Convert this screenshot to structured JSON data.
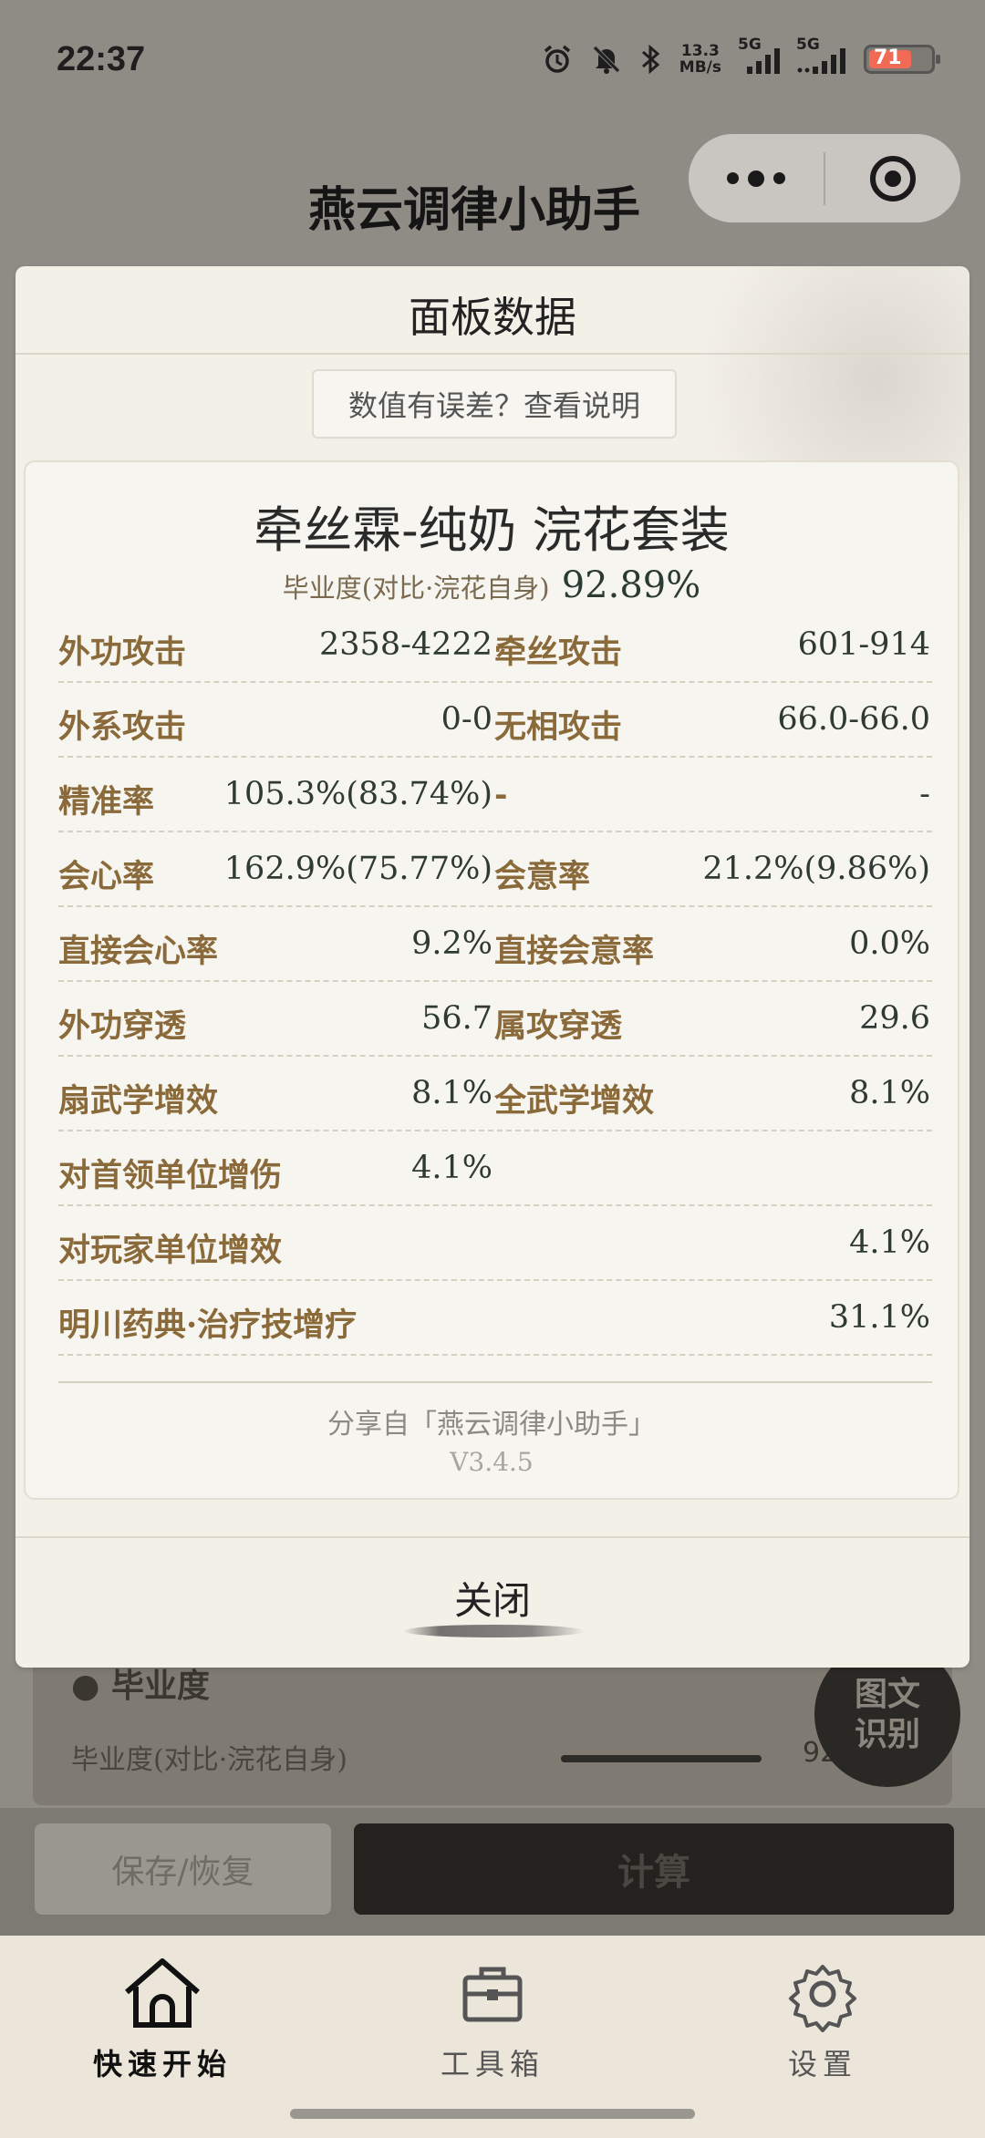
{
  "status_bar": {
    "time": "22:37",
    "net_speed_value": "13.3",
    "net_speed_unit": "MB/s",
    "sim1_label": "5G",
    "sim2_label": "5G",
    "battery": "71",
    "icons": [
      "alarm-icon",
      "mute-icon",
      "bluetooth-icon",
      "signal-icon",
      "battery-icon"
    ]
  },
  "app": {
    "title": "燕云调律小助手"
  },
  "capsule": {
    "icons": [
      "more-icon",
      "target-icon"
    ]
  },
  "modal": {
    "title": "面板数据",
    "error_link": "数值有误差？查看说明",
    "set_title": "牵丝霖-纯奶 浣花套装",
    "score_label": "毕业度(对比·浣花自身)",
    "score_value": "92.89%",
    "rows": [
      {
        "l1": "外功攻击",
        "v1": "2358-4222",
        "l2": "牵丝攻击",
        "v2": "601-914"
      },
      {
        "l1": "外系攻击",
        "v1": "0-0",
        "l2": "无相攻击",
        "v2": "66.0-66.0"
      },
      {
        "l1": "精准率",
        "v1": "105.3%(83.74%)",
        "l2": "-",
        "v2": "-"
      },
      {
        "l1": "会心率",
        "v1": "162.9%(75.77%)",
        "l2": "会意率",
        "v2": "21.2%(9.86%)"
      },
      {
        "l1": "直接会心率",
        "v1": "9.2%",
        "l2": "直接会意率",
        "v2": "0.0%"
      },
      {
        "l1": "外功穿透",
        "v1": "56.7",
        "l2": "属攻穿透",
        "v2": "29.6"
      },
      {
        "l1": "扇武学增效",
        "v1": "8.1%",
        "l2": "全武学增效",
        "v2": "8.1%"
      },
      {
        "l1": "对首领单位增伤",
        "v1": "4.1%",
        "l2": "",
        "v2": ""
      },
      {
        "l1": "对玩家单位增效",
        "v1": "",
        "l2": "",
        "v2": "4.1%"
      },
      {
        "l1": "明川药典·治疗技增疗",
        "v1": "",
        "l2": "",
        "v2": "31.1%"
      }
    ],
    "share_text": "分享自「燕云调律小助手」",
    "version": "V3.4.5",
    "close_label": "关闭"
  },
  "background": {
    "section_heading": "毕业度",
    "score_label": "毕业度(对比·浣花自身)",
    "score_value": "92",
    "ocr_button_line1": "图文",
    "ocr_button_line2": "识别",
    "save_button": "保存/恢复",
    "calc_button": "计算"
  },
  "tabbar": {
    "tabs": [
      {
        "label": "快速开始",
        "icon": "home-icon",
        "active": true
      },
      {
        "label": "工具箱",
        "icon": "toolbox-icon",
        "active": false
      },
      {
        "label": "设置",
        "icon": "gear-icon",
        "active": false
      }
    ]
  },
  "colors": {
    "accent_label": "#8a6a3a",
    "value_text": "#2e3a33",
    "tab_bar_bg": "#ece6da",
    "battery_fill": "#f06a55"
  }
}
